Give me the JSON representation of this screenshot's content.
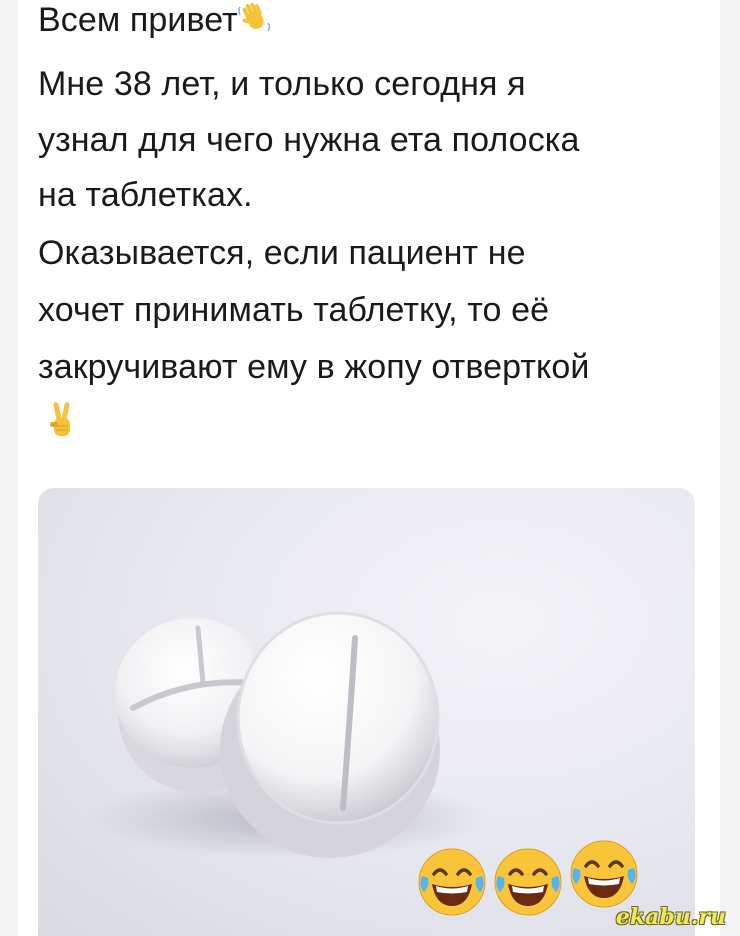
{
  "post": {
    "lines": [
      "Всем привет",
      "Мне 38 лет, и только сегодня я",
      "узнал для чего нужна ета полоска",
      "на таблетках.",
      "Оказывается, если пациент не",
      "хочет принимать таблетку, то её",
      "закручивают ему в жопу отверткой"
    ]
  },
  "icons": {
    "wave": "waving-hand-icon",
    "victory": "victory-hand-icon",
    "laugh": "face-with-tears-of-joy-icon"
  },
  "watermark": "ekabu.ru"
}
